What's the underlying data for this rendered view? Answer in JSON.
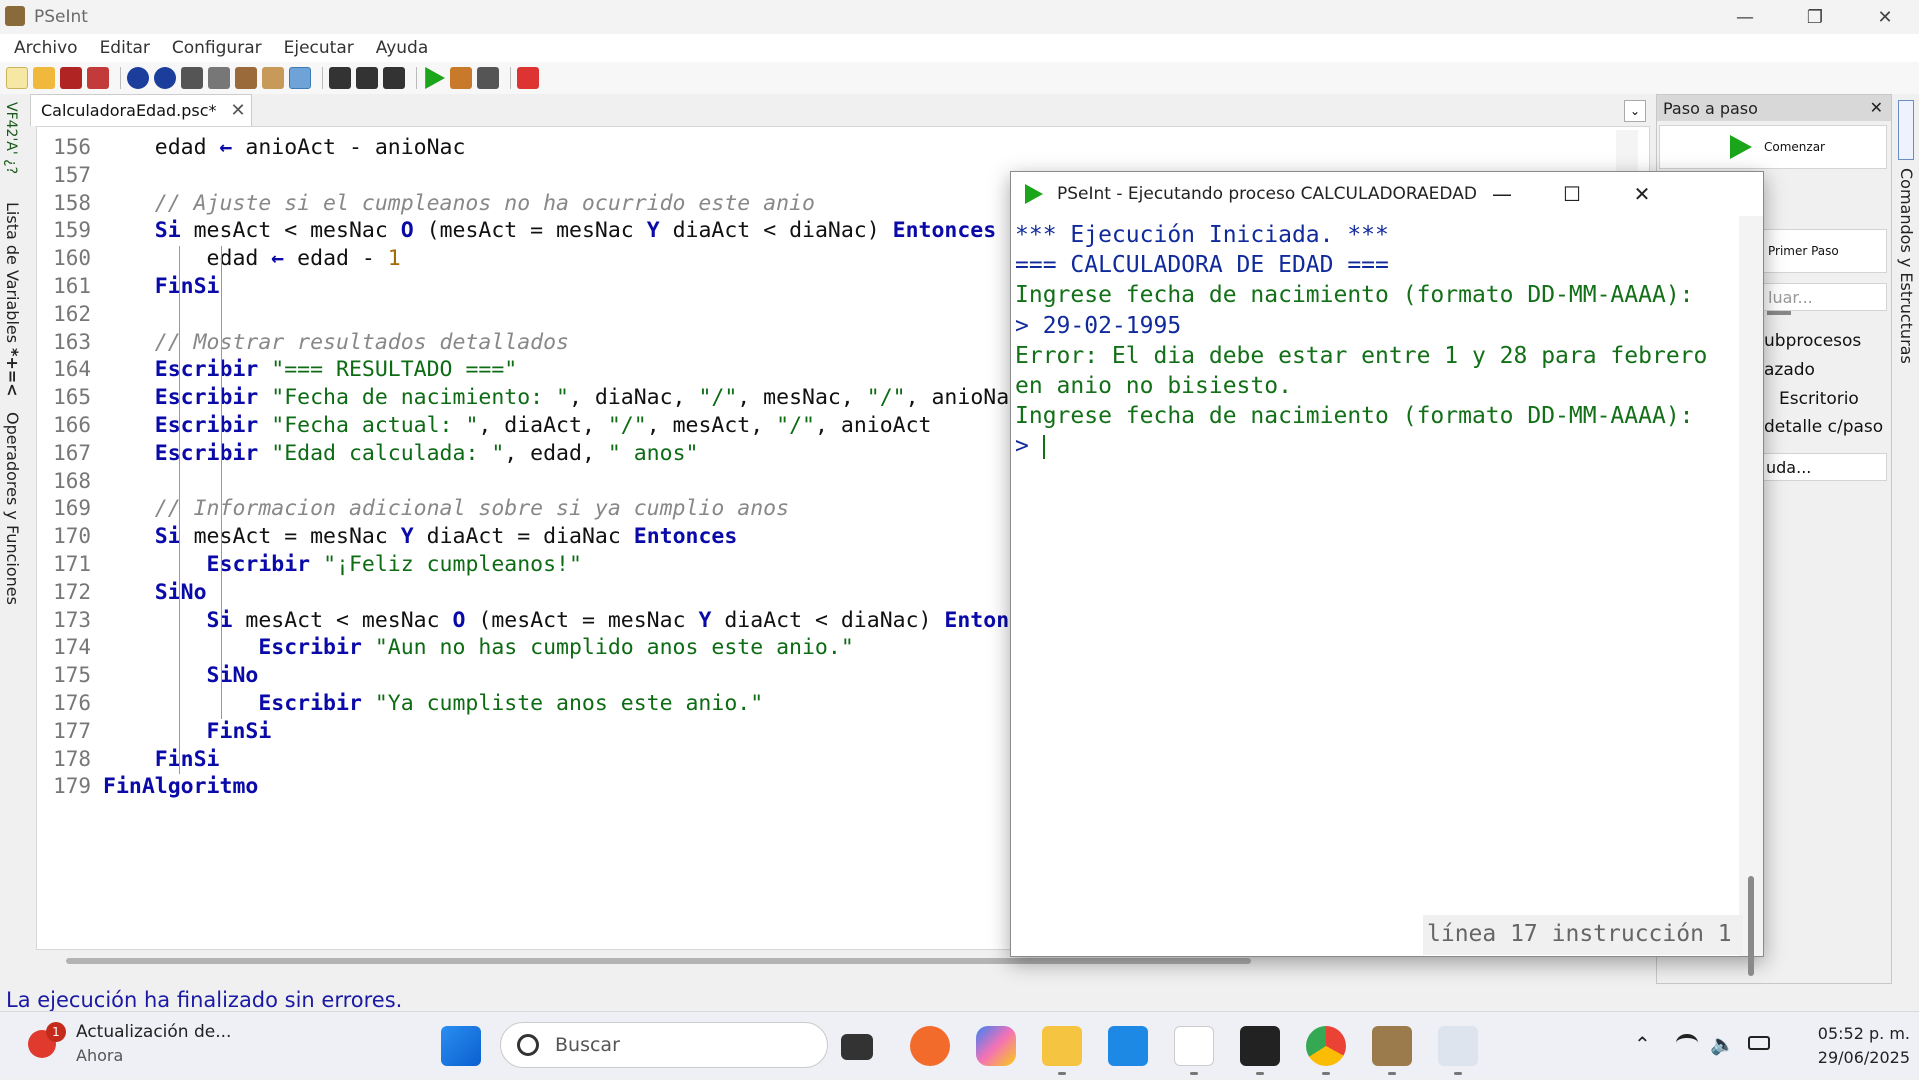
{
  "window": {
    "title": "PSeInt"
  },
  "menu": [
    "Archivo",
    "Editar",
    "Configurar",
    "Ejecutar",
    "Ayuda"
  ],
  "left_strip": {
    "variables": "Lista de Variables",
    "variables_icon": "VF42'A' ¿?",
    "operators": "Operadores y Funciones",
    "operators_icon": "*+=<"
  },
  "tab": {
    "label": "CalculadoraEdad.psc*"
  },
  "editor": {
    "line_numbers": [
      "156",
      "157",
      "158",
      "159",
      "160",
      "161",
      "162",
      "163",
      "164",
      "165",
      "166",
      "167",
      "168",
      "169",
      "170",
      "171",
      "172",
      "173",
      "174",
      "175",
      "176",
      "177",
      "178",
      "179"
    ],
    "lines": [
      {
        "seg": [
          {
            "c": "",
            "t": "    edad "
          },
          {
            "c": "kw",
            "t": "←"
          },
          {
            "c": "",
            "t": " anioAct - anioNac"
          }
        ]
      },
      {
        "seg": []
      },
      {
        "seg": [
          {
            "c": "cm",
            "t": "    // Ajuste si el cumpleanos no ha ocurrido este anio"
          }
        ]
      },
      {
        "seg": [
          {
            "c": "kw",
            "t": "    Si"
          },
          {
            "c": "",
            "t": " mesAct < mesNac "
          },
          {
            "c": "kw",
            "t": "O"
          },
          {
            "c": "",
            "t": " (mesAct = mesNac "
          },
          {
            "c": "kw",
            "t": "Y"
          },
          {
            "c": "",
            "t": " diaAct < diaNac) "
          },
          {
            "c": "kw",
            "t": "Entonces"
          }
        ]
      },
      {
        "seg": [
          {
            "c": "",
            "t": "        edad "
          },
          {
            "c": "kw",
            "t": "←"
          },
          {
            "c": "",
            "t": " edad - "
          },
          {
            "c": "num",
            "t": "1"
          }
        ]
      },
      {
        "seg": [
          {
            "c": "kw",
            "t": "    FinSi"
          }
        ]
      },
      {
        "seg": []
      },
      {
        "seg": [
          {
            "c": "cm",
            "t": "    // Mostrar resultados detallados"
          }
        ]
      },
      {
        "seg": [
          {
            "c": "kw",
            "t": "    Escribir "
          },
          {
            "c": "str",
            "t": "\"=== RESULTADO ===\""
          }
        ]
      },
      {
        "seg": [
          {
            "c": "kw",
            "t": "    Escribir "
          },
          {
            "c": "str",
            "t": "\"Fecha de nacimiento: \""
          },
          {
            "c": "",
            "t": ", diaNac, "
          },
          {
            "c": "str",
            "t": "\"/\""
          },
          {
            "c": "",
            "t": ", mesNac, "
          },
          {
            "c": "str",
            "t": "\"/\""
          },
          {
            "c": "",
            "t": ", anioNac"
          }
        ]
      },
      {
        "seg": [
          {
            "c": "kw",
            "t": "    Escribir "
          },
          {
            "c": "str",
            "t": "\"Fecha actual: \""
          },
          {
            "c": "",
            "t": ", diaAct, "
          },
          {
            "c": "str",
            "t": "\"/\""
          },
          {
            "c": "",
            "t": ", mesAct, "
          },
          {
            "c": "str",
            "t": "\"/\""
          },
          {
            "c": "",
            "t": ", anioAct"
          }
        ]
      },
      {
        "seg": [
          {
            "c": "kw",
            "t": "    Escribir "
          },
          {
            "c": "str",
            "t": "\"Edad calculada: \""
          },
          {
            "c": "",
            "t": ", edad, "
          },
          {
            "c": "str",
            "t": "\" anos\""
          }
        ]
      },
      {
        "seg": []
      },
      {
        "seg": [
          {
            "c": "cm",
            "t": "    // Informacion adicional sobre si ya cumplio anos"
          }
        ]
      },
      {
        "seg": [
          {
            "c": "kw",
            "t": "    Si"
          },
          {
            "c": "",
            "t": " mesAct = mesNac "
          },
          {
            "c": "kw",
            "t": "Y"
          },
          {
            "c": "",
            "t": " diaAct = diaNac "
          },
          {
            "c": "kw",
            "t": "Entonces"
          }
        ]
      },
      {
        "seg": [
          {
            "c": "kw",
            "t": "        Escribir "
          },
          {
            "c": "str",
            "t": "\"¡Feliz cumpleanos!\""
          }
        ]
      },
      {
        "seg": [
          {
            "c": "kw",
            "t": "    SiNo"
          }
        ]
      },
      {
        "seg": [
          {
            "c": "kw",
            "t": "        Si"
          },
          {
            "c": "",
            "t": " mesAct < mesNac "
          },
          {
            "c": "kw",
            "t": "O"
          },
          {
            "c": "",
            "t": " (mesAct = mesNac "
          },
          {
            "c": "kw",
            "t": "Y"
          },
          {
            "c": "",
            "t": " diaAct < diaNac) "
          },
          {
            "c": "kw",
            "t": "Entonces"
          }
        ]
      },
      {
        "seg": [
          {
            "c": "kw",
            "t": "            Escribir "
          },
          {
            "c": "str",
            "t": "\"Aun no has cumplido anos este anio.\""
          }
        ]
      },
      {
        "seg": [
          {
            "c": "kw",
            "t": "        SiNo"
          }
        ]
      },
      {
        "seg": [
          {
            "c": "kw",
            "t": "            Escribir "
          },
          {
            "c": "str",
            "t": "\"Ya cumpliste anos este anio.\""
          }
        ]
      },
      {
        "seg": [
          {
            "c": "kw",
            "t": "        FinSi"
          }
        ]
      },
      {
        "seg": [
          {
            "c": "kw",
            "t": "    FinSi"
          }
        ]
      },
      {
        "seg": [
          {
            "c": "kw",
            "t": "FinAlgoritmo"
          }
        ]
      }
    ]
  },
  "status": {
    "text": "La ejecución ha finalizado sin errores."
  },
  "right_panel": {
    "title": "Paso a paso",
    "start_button": "Comenzar",
    "first_step_button": "Primer Paso",
    "evaluate_button": "luar...",
    "options": [
      "ubprocesos",
      "azado",
      "Escritorio",
      "detalle c/paso"
    ],
    "help_button": "uda...",
    "strip_label": "Comandos y Estructuras"
  },
  "dialog": {
    "title": "PSeInt - Ejecutando proceso CALCULADORAEDAD",
    "console": [
      {
        "c": "blue",
        "t": "*** Ejecución Iniciada. ***"
      },
      {
        "c": "blue",
        "t": "=== CALCULADORA DE EDAD ==="
      },
      {
        "c": "green",
        "t": "Ingrese fecha de nacimiento (formato DD-MM-AAAA):"
      },
      {
        "c": "blue",
        "t": "> 29-02-1995"
      },
      {
        "c": "green",
        "t": "Error: El dia debe estar entre 1 y 28 para febrero"
      },
      {
        "c": "green",
        "t": "en anio no bisiesto."
      },
      {
        "c": "green",
        "t": "Ingrese fecha de nacimiento (formato DD-MM-AAAA):"
      },
      {
        "c": "blue",
        "t": "> "
      }
    ],
    "status": "línea 17 instrucción 1"
  },
  "taskbar": {
    "notification": {
      "title": "Actualización de...",
      "subtitle": "Ahora",
      "badge": "1"
    },
    "search_placeholder": "Buscar",
    "time": "05:52 p. m.",
    "date": "29/06/2025"
  },
  "colors": {
    "keyword": "#0a0aa8",
    "string": "#0d6b14",
    "comment": "#888888",
    "console_blue": "#102a9c",
    "console_green": "#137018",
    "status_blue": "#1a1aa5"
  }
}
